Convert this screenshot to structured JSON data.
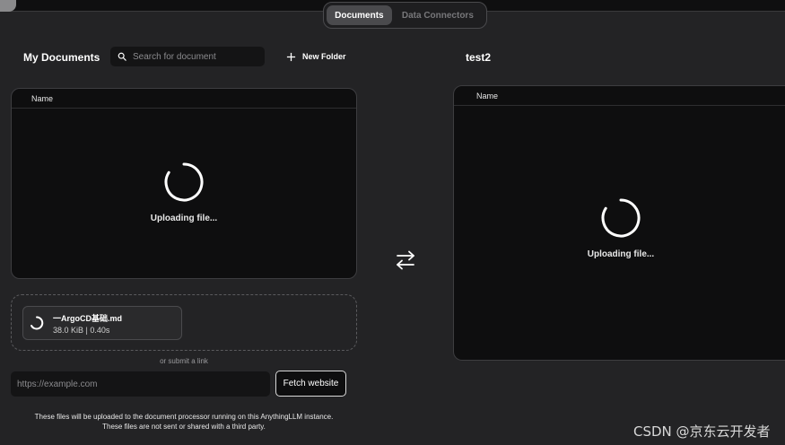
{
  "tabs": {
    "documents": "Documents",
    "data_connectors": "Data Connectors"
  },
  "my_documents": {
    "title": "My Documents",
    "search_placeholder": "Search for document",
    "new_folder": "New Folder",
    "column_name": "Name",
    "status": "Uploading file..."
  },
  "workspace": {
    "title": "test2",
    "column_name": "Name",
    "status": "Uploading file..."
  },
  "upload": {
    "file_name": "一ArgoCD基础.md",
    "file_info": "38.0 KiB | 0.40s",
    "or_link": "or submit a link",
    "url_placeholder": "https://example.com",
    "fetch_button": "Fetch website"
  },
  "notice": {
    "line1": "These files will be uploaded to the document processor running on this AnythingLLM instance.",
    "line2": "These files are not sent or shared with a third party."
  },
  "watermark": "CSDN @京东云开发者",
  "icons": {
    "search": "search-icon",
    "plus": "plus-icon",
    "spinner": "spinner-icon",
    "swap": "swap-arrows-icon"
  }
}
